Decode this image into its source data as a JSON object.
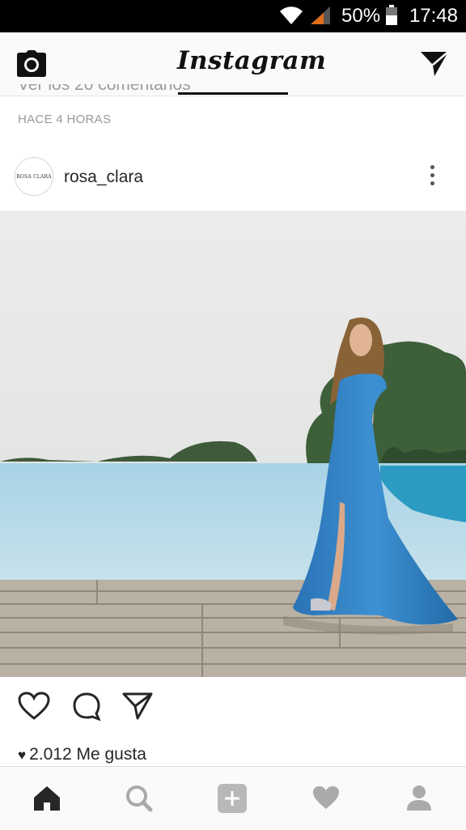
{
  "status_bar": {
    "battery_percent": "50%",
    "time": "17:48"
  },
  "app_bar": {
    "title": "Instagram"
  },
  "previous_post": {
    "comments_link": "Ver los 20 comentarios",
    "time_ago": "HACE 4 HORAS"
  },
  "post": {
    "avatar_text": "ROSA CLARÁ",
    "username": "rosa_clara",
    "likes_count": "2.012",
    "likes_label": "Me gusta"
  },
  "bottom_nav": {
    "items": [
      "home-icon",
      "search-icon",
      "add-post-icon",
      "activity-icon",
      "profile-icon"
    ],
    "active": "home-icon"
  },
  "colors": {
    "dress": "#2f7fc0",
    "pool": "#9ccde6",
    "sky": "#ebebe8"
  }
}
